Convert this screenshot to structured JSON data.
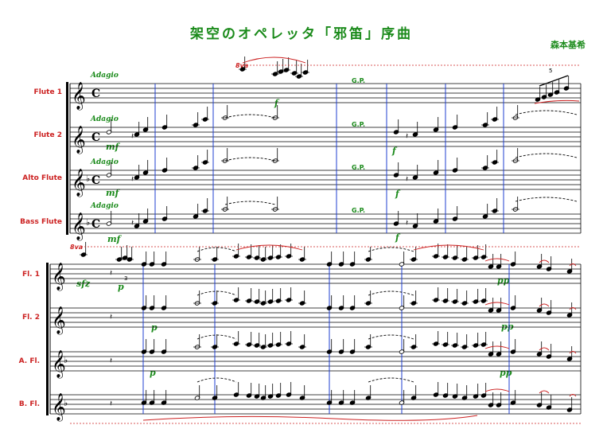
{
  "score": {
    "title": "架空のオペレッタ「邪笛」序曲",
    "composer": "森本基希",
    "system1": {
      "instruments": [
        "Flute 1",
        "Flute 2",
        "Alto Flute",
        "Bass Flute"
      ],
      "tempo": "Adagio",
      "time_signature": "C"
    },
    "system2": {
      "instruments": [
        "Fl. 1",
        "Fl. 2",
        "A. Fl.",
        "B. Fl."
      ]
    },
    "markings": {
      "gp": "G.P.",
      "ottava": "8va",
      "f": "f",
      "mf": "mf",
      "p": "p",
      "pp": "pp",
      "sfz": "sfz",
      "tuplet": "5",
      "triplet": "3"
    },
    "colors": {
      "title": "#1a8a1a",
      "instrument_names": "#cc2222",
      "barlines": "#1f3fd0",
      "dynamics": "#1a8a1a",
      "notes": "#000000"
    }
  }
}
